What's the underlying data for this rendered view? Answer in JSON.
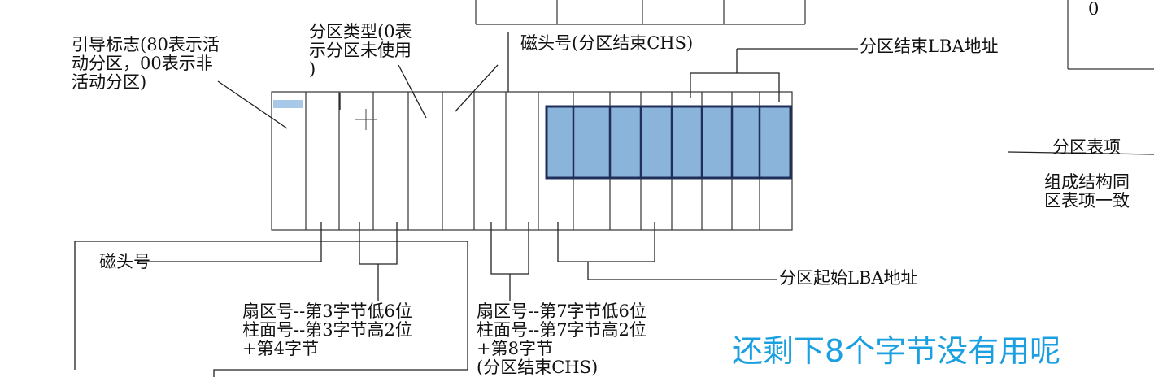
{
  "colors": {
    "highlight_fill": "#8ab4d9",
    "highlight_border": "#1f2f5a",
    "note": "#1a9fe0"
  },
  "labels": {
    "boot_flag": "引导标志(80表示活\n动分区，00表示非\n活动分区)",
    "partition_type": "分区类型(0表\n示分区未使用\n)",
    "head_end": "磁头号(分区结束CHS)",
    "end_lba": "分区结束LBA地址",
    "start_lba": "分区起始LBA地址",
    "head_start": "磁头号",
    "sector_start": "扇区号--第3字节低6位\n柱面号--第3字节高2位\n+第4字节",
    "sector_end": "扇区号--第7字节低6位\n柱面号--第7字节高2位\n+第8字节\n(分区结束CHS)",
    "entry_title": "分区表项",
    "entry_desc": "组成结构同\n区表项一致",
    "zero": "0"
  },
  "annotation": "还剩下8个字节没有用呢",
  "icons": [
    "crosshair-cursor-icon"
  ]
}
